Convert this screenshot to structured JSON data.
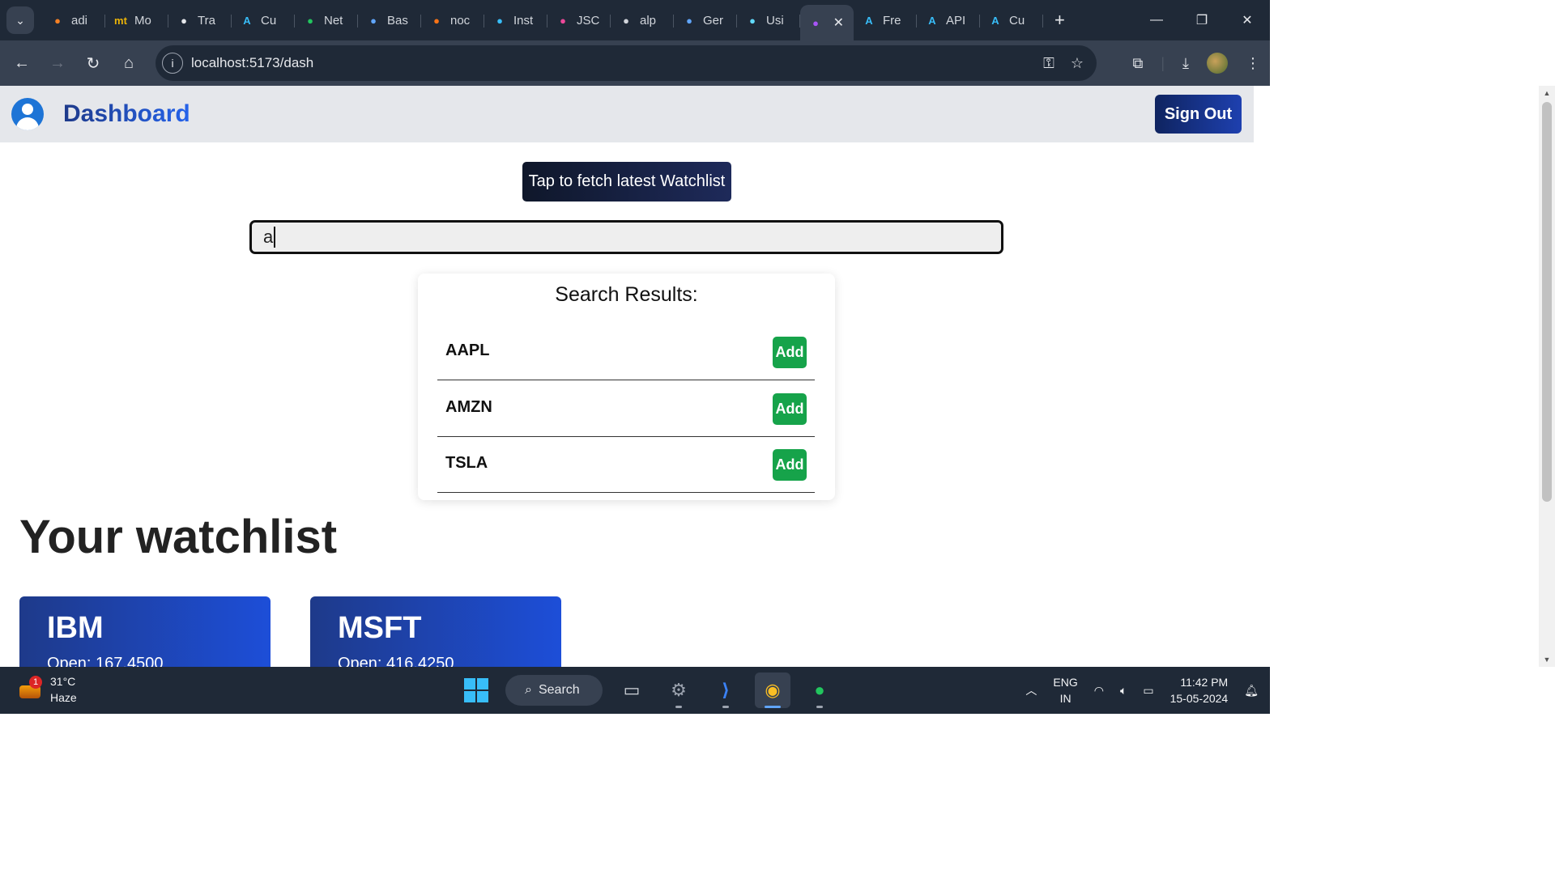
{
  "browser": {
    "tabs": [
      {
        "label": "adi",
        "icon": "stackoverflow-icon",
        "color": "#f48024"
      },
      {
        "label": "Mo",
        "icon": "mt-icon",
        "color": "#eab308"
      },
      {
        "label": "Tra",
        "icon": "openai-icon",
        "color": "#e5e7eb"
      },
      {
        "label": "Cu",
        "icon": "letter-a-icon",
        "color": "#38bdf8"
      },
      {
        "label": "Net",
        "icon": "leaf-icon",
        "color": "#22c55e"
      },
      {
        "label": "Bas",
        "icon": "diamond-icon",
        "color": "#60a5fa"
      },
      {
        "label": "noc",
        "icon": "stack-icon",
        "color": "#f97316"
      },
      {
        "label": "Inst",
        "icon": "tailwind-icon",
        "color": "#38bdf8"
      },
      {
        "label": "JSC",
        "icon": "jscolor-icon",
        "color": "#ec4899"
      },
      {
        "label": "alp",
        "icon": "globe-icon",
        "color": "#d1d5db"
      },
      {
        "label": "Ger",
        "icon": "sparkle-icon",
        "color": "#60a5fa"
      },
      {
        "label": "Usi",
        "icon": "react-icon",
        "color": "#61dafb"
      },
      {
        "label": "",
        "icon": "vite-icon",
        "color": "#a855f7",
        "active": true
      },
      {
        "label": "Fre",
        "icon": "letter-a-icon",
        "color": "#38bdf8"
      },
      {
        "label": "API",
        "icon": "letter-a-icon",
        "color": "#38bdf8"
      },
      {
        "label": "Cu",
        "icon": "letter-a-icon",
        "color": "#38bdf8"
      }
    ],
    "url": "localhost:5173/dash"
  },
  "app": {
    "title": "Dashboard",
    "sign_out": "Sign Out",
    "fetch_button": "Tap to fetch latest Watchlist",
    "search_value": "a",
    "results_title": "Search Results:",
    "add_label": "Add",
    "results": [
      "AAPL",
      "AMZN",
      "TSLA"
    ],
    "watchlist_title": "Your watchlist",
    "cards": [
      {
        "symbol": "IBM",
        "open": "Open: 167.4500"
      },
      {
        "symbol": "MSFT",
        "open": "Open: 416.4250"
      }
    ]
  },
  "taskbar": {
    "weather_temp": "31°C",
    "weather_desc": "Haze",
    "weather_badge": "1",
    "search_label": "Search",
    "lang_1": "ENG",
    "lang_2": "IN",
    "time": "11:42 PM",
    "date": "15-05-2024"
  }
}
